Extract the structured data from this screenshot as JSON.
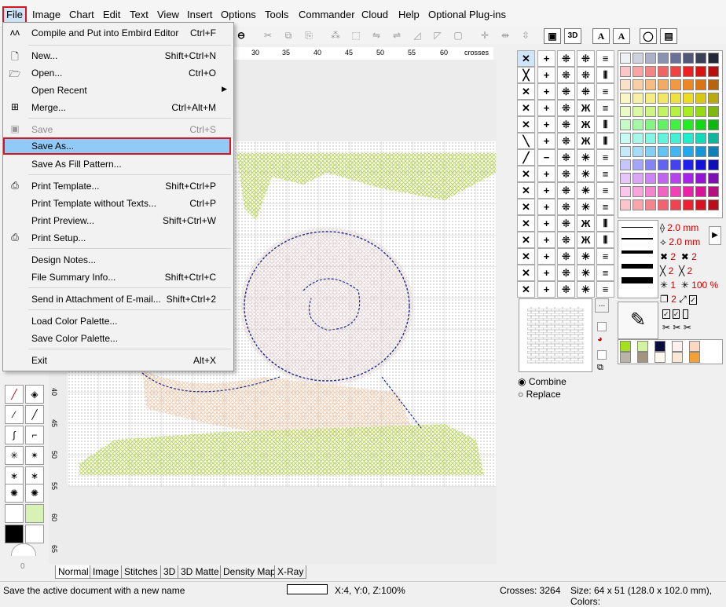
{
  "menubar": {
    "items": [
      "File",
      "Image",
      "Chart",
      "Edit",
      "Text",
      "View",
      "Insert",
      "Options",
      "Tools",
      "Commander",
      "Cloud",
      "Help",
      "Optional Plug-ins"
    ]
  },
  "file_menu": {
    "items": [
      {
        "label": "Compile and Put into Embird Editor",
        "shortcut": "Ctrl+F",
        "icon": "compile-icon"
      },
      {
        "label": "New...",
        "shortcut": "Shift+Ctrl+N",
        "icon": "new-document-icon"
      },
      {
        "label": "Open...",
        "shortcut": "Ctrl+O",
        "icon": "open-folder-icon"
      },
      {
        "label": "Open Recent",
        "shortcut": "",
        "icon": ""
      },
      {
        "label": "Merge...",
        "shortcut": "Ctrl+Alt+M",
        "icon": "merge-icon"
      },
      {
        "label": "Save",
        "shortcut": "Ctrl+S",
        "icon": "save-icon",
        "disabled": true
      },
      {
        "label": "Save As...",
        "shortcut": "",
        "highlighted": true
      },
      {
        "label": "Save As Fill Pattern...",
        "shortcut": ""
      },
      {
        "label": "Print Template...",
        "shortcut": "Shift+Ctrl+P",
        "icon": "printer-icon"
      },
      {
        "label": "Print Template without Texts...",
        "shortcut": "Ctrl+P"
      },
      {
        "label": "Print Preview...",
        "shortcut": "Shift+Ctrl+W"
      },
      {
        "label": "Print Setup...",
        "shortcut": "",
        "icon": "print-setup-icon"
      },
      {
        "label": "Design Notes...",
        "shortcut": ""
      },
      {
        "label": "File Summary Info...",
        "shortcut": "Shift+Ctrl+C"
      },
      {
        "label": "Send in Attachment of E-mail...",
        "shortcut": "Shift+Ctrl+2"
      },
      {
        "label": "Load Color Palette...",
        "shortcut": ""
      },
      {
        "label": "Save Color Palette...",
        "shortcut": ""
      },
      {
        "label": "Exit",
        "shortcut": "Alt+X"
      }
    ]
  },
  "ruler": {
    "h_ticks": [
      "30",
      "35",
      "40",
      "45",
      "50",
      "55",
      "60"
    ],
    "h_unit": "crosses",
    "v_ticks": [
      "40",
      "45",
      "50",
      "55",
      "60",
      "65"
    ]
  },
  "right_panel": {
    "size1": "2.0 mm",
    "size2": "2.0 mm",
    "count1": "2",
    "count2": "2",
    "count3": "2",
    "count4": "2",
    "opacity_a": "1",
    "opacity_b": "100 %",
    "layer_count": "2",
    "combine_label": "Combine",
    "replace_label": "Replace",
    "more_btn": "..."
  },
  "left_tools": {
    "zero_label": "0"
  },
  "tabs": [
    "Normal",
    "Image",
    "Stitches",
    "3D",
    "3D Matte",
    "Density Map",
    "X-Ray"
  ],
  "status": {
    "message": "Save the active document with a new name",
    "coords": "X:4, Y:0, Z:100%",
    "crosses": "Crosses: 3264",
    "size": "Size: 64 x 51 (128.0 x 102.0 mm), Colors:"
  },
  "colors": {
    "menu_highlight": "#91c9f7",
    "focus_outline": "#d8141e",
    "pattern_green": "#b5d64a",
    "snail_shell_border": "#1a2a8c",
    "snail_body": "#f6c9a8"
  }
}
